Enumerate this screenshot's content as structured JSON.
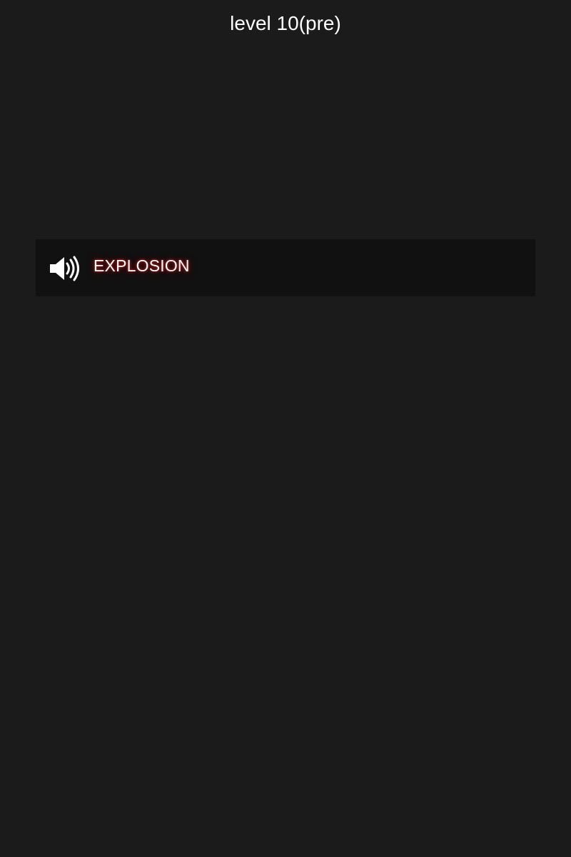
{
  "header": {
    "title": "level 10(pre)"
  },
  "sounds": {
    "items": [
      {
        "label": "EXPLOSION",
        "icon": "speaker-volume-icon"
      }
    ]
  },
  "colors": {
    "background": "#1b1b1b",
    "row_background": "#111111",
    "text": "#ffffff",
    "label_glow": "#c21f1f"
  }
}
